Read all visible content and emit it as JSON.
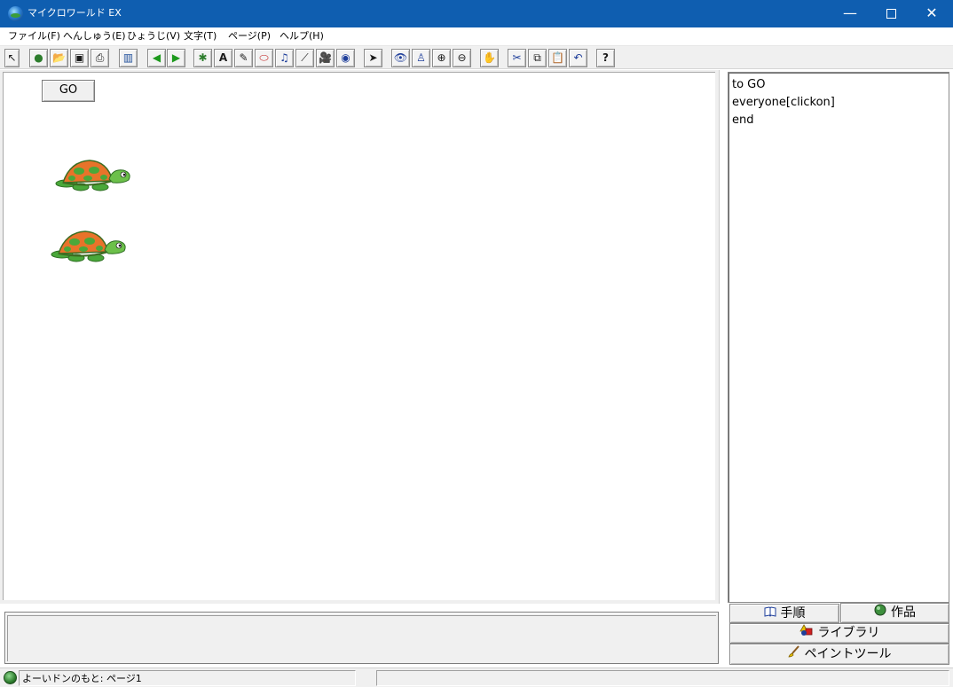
{
  "window": {
    "title": "マイクロワールド EX",
    "minimize_glyph": "—",
    "close_glyph": "✕"
  },
  "menu": {
    "items": [
      "ファイル(F)",
      "へんしゅう(E)",
      "ひょうじ(V)",
      "文字(T)",
      "ページ(P)",
      "ヘルプ(H)"
    ]
  },
  "toolbar": {
    "buttons": [
      {
        "name": "select-arrow-icon",
        "glyph": "↖"
      },
      {
        "name": "new-project-icon",
        "glyph": "●"
      },
      {
        "name": "open-folder-icon",
        "glyph": "📂"
      },
      {
        "name": "save-disk-icon",
        "glyph": "▣"
      },
      {
        "name": "print-icon",
        "glyph": "⎙"
      },
      {
        "name": "page-layout-icon",
        "glyph": "▥"
      },
      {
        "name": "previous-page-icon",
        "glyph": "◀"
      },
      {
        "name": "next-page-icon",
        "glyph": "▶"
      },
      {
        "name": "new-turtle-icon",
        "glyph": "✱"
      },
      {
        "name": "text-box-icon",
        "glyph": "A"
      },
      {
        "name": "draw-tool-icon",
        "glyph": "✎"
      },
      {
        "name": "button-tool-icon",
        "glyph": "⬭"
      },
      {
        "name": "music-icon",
        "glyph": "♫"
      },
      {
        "name": "slider-icon",
        "glyph": "⟋"
      },
      {
        "name": "video-icon",
        "glyph": "🎥"
      },
      {
        "name": "sound-icon",
        "glyph": "◉"
      },
      {
        "name": "pointer-icon",
        "glyph": "➤"
      },
      {
        "name": "eye-icon",
        "glyph": "👁"
      },
      {
        "name": "stamp-icon",
        "glyph": "♙"
      },
      {
        "name": "zoom-in-icon",
        "glyph": "⊕"
      },
      {
        "name": "zoom-out-icon",
        "glyph": "⊖"
      },
      {
        "name": "stop-hand-icon",
        "glyph": "✋"
      },
      {
        "name": "cut-scissors-icon",
        "glyph": "✂"
      },
      {
        "name": "copy-icon",
        "glyph": "⧉"
      },
      {
        "name": "paste-clipboard-icon",
        "glyph": "📋"
      },
      {
        "name": "undo-icon",
        "glyph": "↶"
      },
      {
        "name": "help-icon",
        "glyph": "?"
      }
    ]
  },
  "canvas": {
    "go_button_label": "GO"
  },
  "code": {
    "lines": [
      "to GO",
      "everyone[clickon]",
      "end"
    ]
  },
  "tabs": {
    "procedures": "手順",
    "project": "作品",
    "library": "ライブラリ",
    "paint_tools": "ペイントツール"
  },
  "status": {
    "text": "よーいドンのもと: ページ1"
  },
  "colors": {
    "titlebar": "#0f5eb0",
    "turtle_shell": "#e8732a",
    "turtle_body": "#4aa83a"
  }
}
